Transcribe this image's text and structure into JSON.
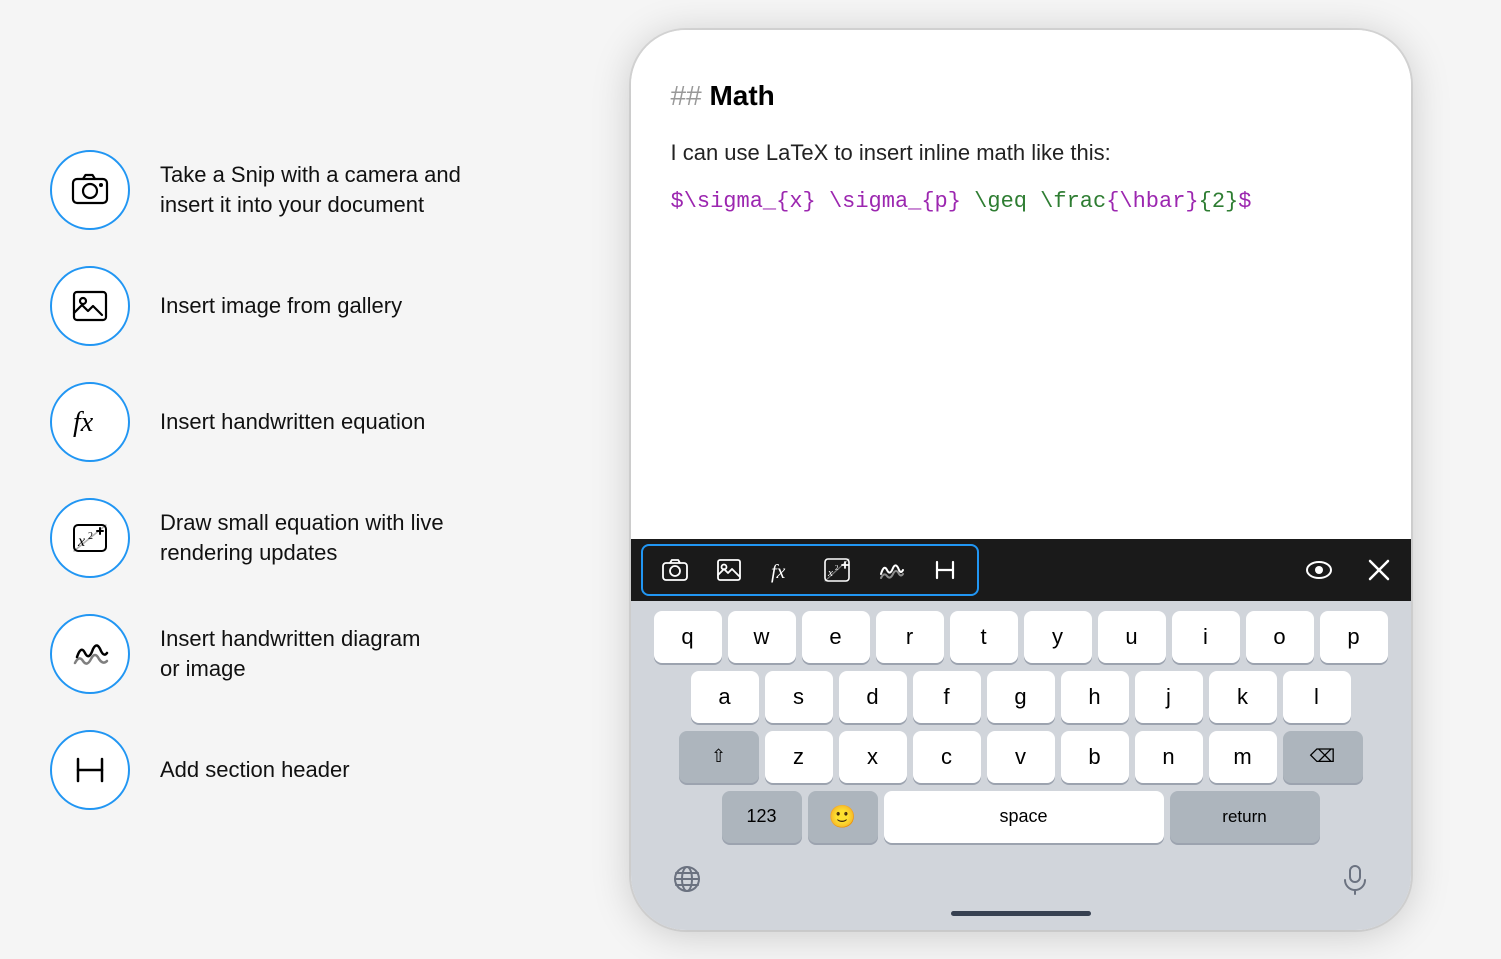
{
  "leftPanel": {
    "features": [
      {
        "id": "camera",
        "label": "Take a Snip with a camera and\ninsert it into your document",
        "iconType": "camera"
      },
      {
        "id": "gallery",
        "label": "Insert image from gallery",
        "iconType": "image"
      },
      {
        "id": "equation",
        "label": "Insert handwritten equation",
        "iconType": "fx"
      },
      {
        "id": "draw-equation",
        "label": "Draw small equation with live\nrendering updates",
        "iconType": "draw-eq"
      },
      {
        "id": "diagram",
        "label": "Insert handwritten diagram\nor image",
        "iconType": "scribble"
      },
      {
        "id": "header",
        "label": "Add section header",
        "iconType": "header"
      }
    ]
  },
  "phone": {
    "docHeading": "## Math",
    "docText": "I can use LaTeX to insert inline math like this:",
    "latexCode": "$\\sigma_{x} \\sigma_{p} \\geq \\frac{\\hbar}{2}$",
    "toolbar": {
      "buttons": [
        "camera",
        "image",
        "fx",
        "draw-eq",
        "scribble",
        "H"
      ]
    },
    "keyboard": {
      "rows": [
        [
          "q",
          "w",
          "e",
          "r",
          "t",
          "y",
          "u",
          "i",
          "o",
          "p"
        ],
        [
          "a",
          "s",
          "d",
          "f",
          "g",
          "h",
          "j",
          "k",
          "l"
        ],
        [
          "⇧",
          "z",
          "x",
          "c",
          "v",
          "b",
          "n",
          "m",
          "⌫"
        ],
        [
          "123",
          "😊",
          "space",
          "return"
        ]
      ]
    }
  },
  "colors": {
    "accent": "#2196f3",
    "purple": "#9c27b0",
    "green": "#2e7d32",
    "toolbar_bg": "#1a1a1a",
    "keyboard_bg": "#d1d5db"
  }
}
